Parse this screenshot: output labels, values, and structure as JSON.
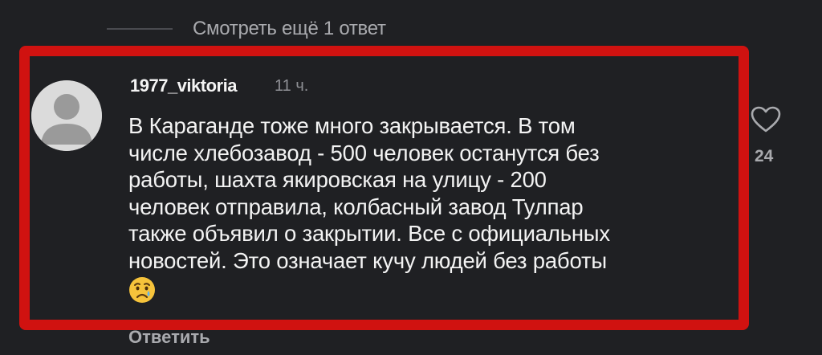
{
  "thread": {
    "view_more_label": "Смотреть ещё 1 ответ"
  },
  "comment": {
    "username": "1977_viktoria",
    "timestamp": "11 ч.",
    "lines": [
      "В Караганде тоже много закрывается. В том",
      "числе хлебозавод - 500 человек останутся без",
      "работы, шахта якировская на улицу - 200",
      "человек отправила, колбасный завод Тулпар",
      "также объявил о закрытии. Все с официальных",
      "новостей. Это означает кучу людей без работы"
    ],
    "emoji": "crying-face",
    "like_count": "24",
    "reply_label": "Ответить"
  },
  "colors": {
    "background": "#1f2023",
    "highlight_border": "#d01210",
    "muted_text": "#a9aaae",
    "avatar_bg": "#dbdbdb",
    "avatar_fg": "#9a9a9a"
  },
  "icons": {
    "like": "heart-outline-icon",
    "avatar": "default-user-avatar-icon"
  }
}
